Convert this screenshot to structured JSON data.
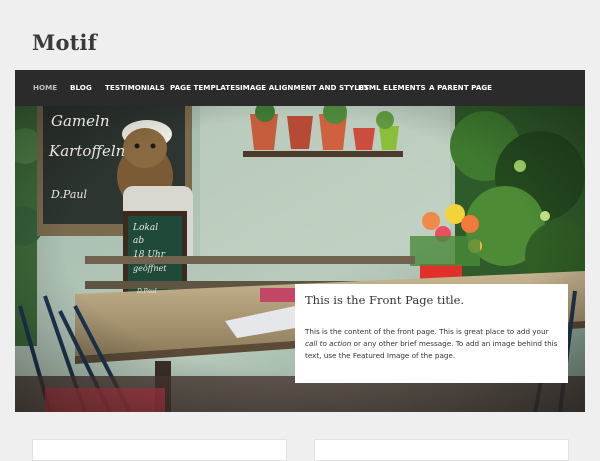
{
  "site": {
    "title": "Motif"
  },
  "nav": {
    "items": [
      {
        "label": "HOME",
        "active": true
      },
      {
        "label": "BLOG"
      },
      {
        "label": "TESTIMONIALS"
      },
      {
        "label": "PAGE TEMPLATES"
      },
      {
        "label": "IMAGE ALIGNMENT AND STYLES"
      },
      {
        "label": "HTML ELEMENTS"
      },
      {
        "label": "A PARENT PAGE"
      }
    ]
  },
  "hero": {
    "chalkboard_text": [
      "Gameln",
      "Kartoffeln",
      "D.Paul"
    ],
    "small_sign_text": [
      "Lokal",
      "ab",
      "18 Uhr",
      "geöffnet",
      "D.Paul"
    ],
    "title": "This is the Front Page title.",
    "body_before": "This is the content of the front page. This is great place to add your ",
    "body_emphasis": "call to action",
    "body_after": " or any other brief message. To add an image behind this text, use the Featured Image of the page."
  },
  "colors": {
    "nav_background": "#2b2b2b",
    "page_background": "#efefef",
    "accent_red": "#e0302a",
    "pot_red": "#d84b3a"
  }
}
